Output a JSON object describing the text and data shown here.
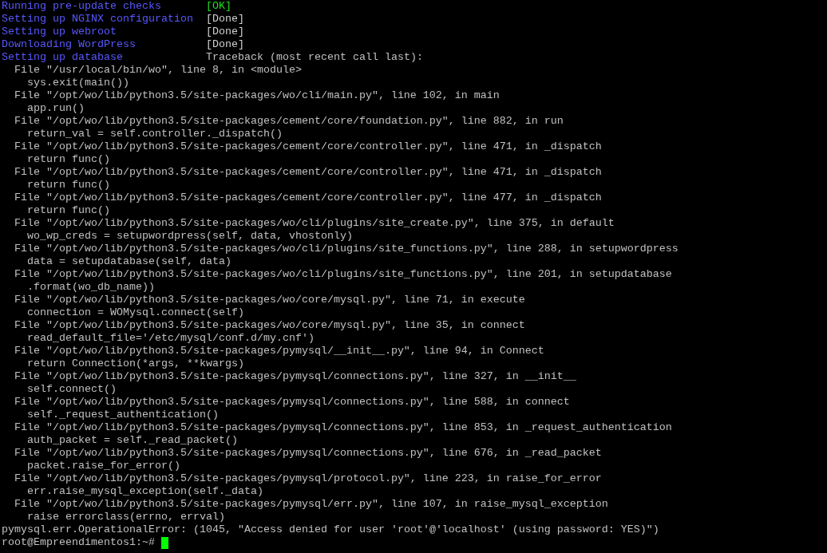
{
  "steps": [
    {
      "label": "Running pre-update checks",
      "status": "[OK]",
      "kind": "ok"
    },
    {
      "label": "Setting up NGINX configuration",
      "status": "[Done]",
      "kind": "done"
    },
    {
      "label": "Setting up webroot",
      "status": "[Done]",
      "kind": "done"
    },
    {
      "label": "Downloading WordPress",
      "status": "[Done]",
      "kind": "done"
    },
    {
      "label": "Setting up database",
      "status": "Traceback (most recent call last):",
      "kind": "output"
    }
  ],
  "frames": [
    {
      "location": "File \"/usr/local/bin/wo\", line 8, in <module>",
      "code": "sys.exit(main())"
    },
    {
      "location": "File \"/opt/wo/lib/python3.5/site-packages/wo/cli/main.py\", line 102, in main",
      "code": "app.run()"
    },
    {
      "location": "File \"/opt/wo/lib/python3.5/site-packages/cement/core/foundation.py\", line 882, in run",
      "code": "return_val = self.controller._dispatch()"
    },
    {
      "location": "File \"/opt/wo/lib/python3.5/site-packages/cement/core/controller.py\", line 471, in _dispatch",
      "code": "return func()"
    },
    {
      "location": "File \"/opt/wo/lib/python3.5/site-packages/cement/core/controller.py\", line 471, in _dispatch",
      "code": "return func()"
    },
    {
      "location": "File \"/opt/wo/lib/python3.5/site-packages/cement/core/controller.py\", line 477, in _dispatch",
      "code": "return func()"
    },
    {
      "location": "File \"/opt/wo/lib/python3.5/site-packages/wo/cli/plugins/site_create.py\", line 375, in default",
      "code": "wo_wp_creds = setupwordpress(self, data, vhostonly)"
    },
    {
      "location": "File \"/opt/wo/lib/python3.5/site-packages/wo/cli/plugins/site_functions.py\", line 288, in setupwordpress",
      "code": "data = setupdatabase(self, data)"
    },
    {
      "location": "File \"/opt/wo/lib/python3.5/site-packages/wo/cli/plugins/site_functions.py\", line 201, in setupdatabase",
      "code": ".format(wo_db_name))"
    },
    {
      "location": "File \"/opt/wo/lib/python3.5/site-packages/wo/core/mysql.py\", line 71, in execute",
      "code": "connection = WOMysql.connect(self)"
    },
    {
      "location": "File \"/opt/wo/lib/python3.5/site-packages/wo/core/mysql.py\", line 35, in connect",
      "code": "read_default_file='/etc/mysql/conf.d/my.cnf')"
    },
    {
      "location": "File \"/opt/wo/lib/python3.5/site-packages/pymysql/__init__.py\", line 94, in Connect",
      "code": "return Connection(*args, **kwargs)"
    },
    {
      "location": "File \"/opt/wo/lib/python3.5/site-packages/pymysql/connections.py\", line 327, in __init__",
      "code": "self.connect()"
    },
    {
      "location": "File \"/opt/wo/lib/python3.5/site-packages/pymysql/connections.py\", line 588, in connect",
      "code": "self._request_authentication()"
    },
    {
      "location": "File \"/opt/wo/lib/python3.5/site-packages/pymysql/connections.py\", line 853, in _request_authentication",
      "code": "auth_packet = self._read_packet()"
    },
    {
      "location": "File \"/opt/wo/lib/python3.5/site-packages/pymysql/connections.py\", line 676, in _read_packet",
      "code": "packet.raise_for_error()"
    },
    {
      "location": "File \"/opt/wo/lib/python3.5/site-packages/pymysql/protocol.py\", line 223, in raise_for_error",
      "code": "err.raise_mysql_exception(self._data)"
    },
    {
      "location": "File \"/opt/wo/lib/python3.5/site-packages/pymysql/err.py\", line 107, in raise_mysql_exception",
      "code": "raise errorclass(errno, errval)"
    }
  ],
  "error": "pymysql.err.OperationalError: (1045, \"Access denied for user 'root'@'localhost' (using password: YES)\")",
  "prompt": "root@Empreendimentos1:~#"
}
